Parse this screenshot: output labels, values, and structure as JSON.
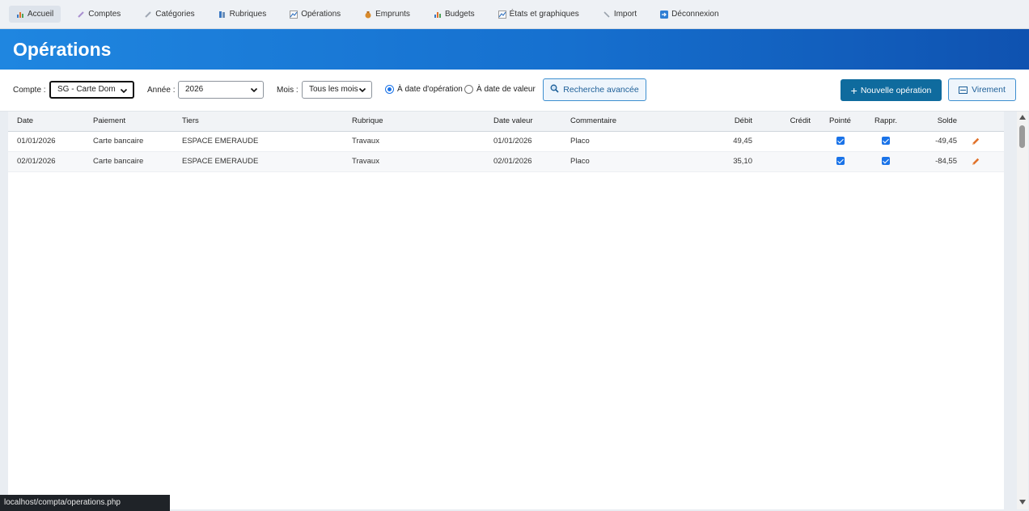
{
  "nav": {
    "items": [
      {
        "label": "Accueil",
        "icon": "bar-chart-icon",
        "active": true
      },
      {
        "label": "Comptes",
        "icon": "pencil-icon"
      },
      {
        "label": "Catégories",
        "icon": "pencil-icon"
      },
      {
        "label": "Rubriques",
        "icon": "books-icon"
      },
      {
        "label": "Opérations",
        "icon": "line-chart-icon"
      },
      {
        "label": "Emprunts",
        "icon": "money-bag-icon"
      },
      {
        "label": "Budgets",
        "icon": "bar-chart-icon"
      },
      {
        "label": "États et graphiques",
        "icon": "line-chart-icon"
      },
      {
        "label": "Import",
        "icon": "wrench-icon"
      },
      {
        "label": "Déconnexion",
        "icon": "arrow-right-icon"
      }
    ]
  },
  "header": {
    "title": "Opérations"
  },
  "filters": {
    "account_label": "Compte :",
    "account_value": "SG - Carte Dom",
    "year_label": "Année :",
    "year_value": "2026",
    "month_label": "Mois :",
    "month_value": "Tous les mois",
    "radio_operation": "À date d'opération",
    "radio_value": "À date de valeur",
    "search_button": "Recherche avancée",
    "new_button": "Nouvelle opération",
    "transfer_button": "Virement"
  },
  "table": {
    "columns": [
      "Date",
      "Paiement",
      "Tiers",
      "Rubrique",
      "Date valeur",
      "Commentaire",
      "Débit",
      "Crédit",
      "Pointé",
      "Rappr.",
      "Solde"
    ],
    "rows": [
      {
        "date": "01/01/2026",
        "paiement": "Carte bancaire",
        "tiers": "ESPACE EMERAUDE",
        "rubrique": "Travaux",
        "date_valeur": "01/01/2026",
        "commentaire": "Placo",
        "debit": "49,45",
        "credit": "",
        "pointe": true,
        "rappr": true,
        "solde": "-49,45"
      },
      {
        "date": "02/01/2026",
        "paiement": "Carte bancaire",
        "tiers": "ESPACE EMERAUDE",
        "rubrique": "Travaux",
        "date_valeur": "02/01/2026",
        "commentaire": "Placo",
        "debit": "35,10",
        "credit": "",
        "pointe": true,
        "rappr": true,
        "solde": "-84,55"
      }
    ]
  },
  "status": {
    "text": "localhost/compta/operations.php"
  },
  "colors": {
    "header_start": "#1f86e0",
    "header_end": "#0f52b0",
    "primary_button": "#0f6b9e",
    "edit_icon": "#e0712b"
  }
}
